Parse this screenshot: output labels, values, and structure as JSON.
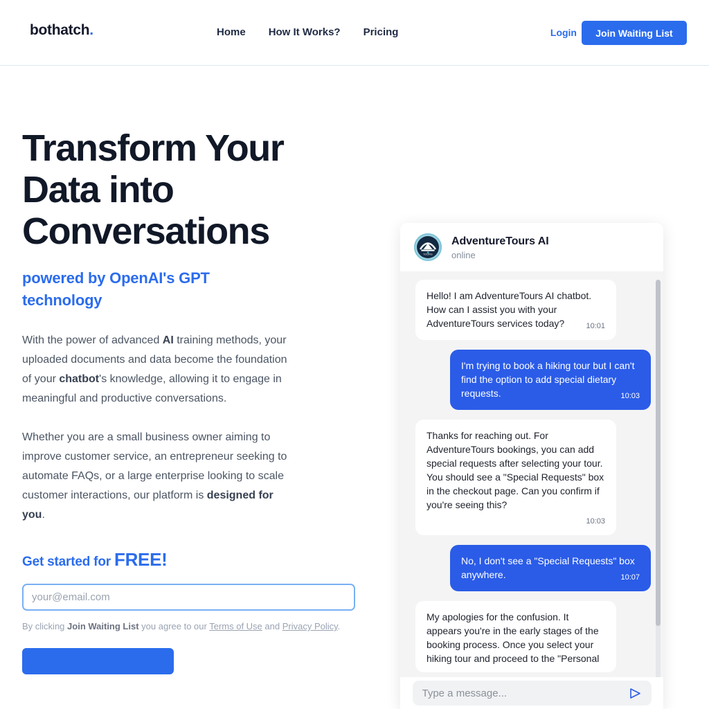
{
  "colors": {
    "brand_blue": "#2b6ced",
    "user_bubble": "#2b5ce8",
    "title_dark": "#111827",
    "body_gray": "#4b5563",
    "chat_bg": "#f4f4f5",
    "input_focus_border": "#79b0f3"
  },
  "header": {
    "brand": "bothatch",
    "brand_dot": ".",
    "nav": [
      {
        "label": "Home"
      },
      {
        "label": "How It Works?"
      },
      {
        "label": "Pricing"
      }
    ],
    "login_label": "Login",
    "cta_label": "Join Waiting List"
  },
  "hero": {
    "title": "Transform Your Data into Conversations",
    "subtitle": "powered by OpenAI's GPT technology",
    "paragraph1_part1": "With the power of advanced ",
    "paragraph1_bold1": "AI",
    "paragraph1_part2": " training methods, your uploaded documents and data become the foundation of your ",
    "paragraph1_bold2": "chatbot",
    "paragraph1_part3": "'s knowledge, allowing it to engage in meaningful and productive conversations.",
    "paragraph2_part1": "Whether you are a small business owner aiming to improve customer service, an entrepreneur seeking to automate FAQs, or a large enterprise looking to scale customer interactions, our platform is ",
    "paragraph2_bold1": "designed for you",
    "paragraph2_part2": ".",
    "free_heading_small": "Get started for ",
    "free_heading_big": "FREE!",
    "email_placeholder": "your@email.com",
    "email_value": "",
    "legal_part1": "By clicking ",
    "legal_bold": "Join Waiting List",
    "legal_part2": " you agree to our ",
    "legal_link1": "Terms of Use",
    "legal_part3": " and ",
    "legal_link2": "Privacy Policy",
    "legal_part4": ".",
    "submit_label": ""
  },
  "chat": {
    "avatar_icon": "adventuretours-logo-icon",
    "avatar_brand_text": "TOURS",
    "title": "AdventureTours AI",
    "status": "online",
    "input_placeholder": "Type a message...",
    "input_value": "",
    "send_icon": "send-icon",
    "messages": [
      {
        "sender": "bot",
        "text": "Hello! I am AdventureTours AI chatbot. How can I assist you with your AdventureTours services today?",
        "time": "10:01"
      },
      {
        "sender": "user",
        "text": "I'm trying to book a hiking tour but I can't find the option to add special dietary requests.",
        "time": "10:03"
      },
      {
        "sender": "bot",
        "text": "Thanks for reaching out. For AdventureTours bookings, you can add special requests after selecting your tour. You should see a \"Special Requests\" box in the checkout page. Can you confirm if you're seeing this?",
        "time": "10:03"
      },
      {
        "sender": "user",
        "text": "No, I don't see a \"Special Requests\" box anywhere.",
        "time": "10:07"
      },
      {
        "sender": "bot",
        "text": "My apologies for the confusion. It appears you're in the early stages of the booking process. Once you select your hiking tour and proceed to the \"Personal",
        "time": ""
      }
    ]
  }
}
